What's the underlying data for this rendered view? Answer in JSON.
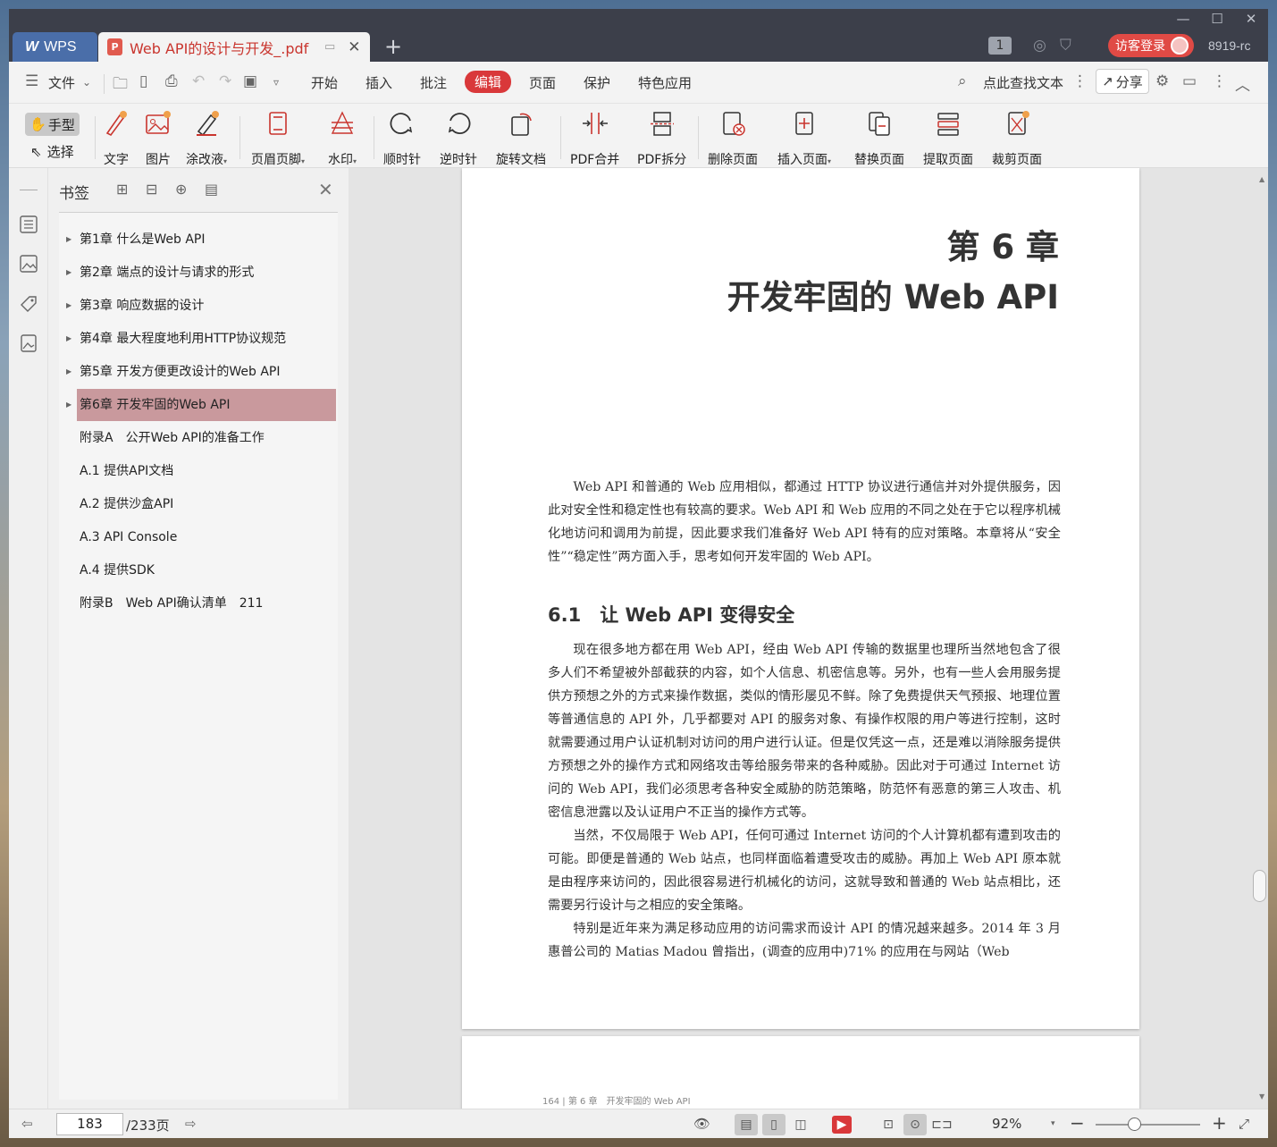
{
  "titlebar": {
    "wps_tab": "WPS",
    "doc_tab": "Web API的设计与开发_.pdf",
    "page_badge": "1",
    "login_button": "访客登录",
    "user_id": "8919-rc"
  },
  "menu": {
    "file": "文件",
    "items": [
      "开始",
      "插入",
      "批注",
      "编辑",
      "页面",
      "保护",
      "特色应用"
    ],
    "active": "编辑",
    "search_text": "点此查找文本",
    "share": "分享"
  },
  "toolbar": {
    "hand": "手型",
    "select": "选择",
    "tools": [
      "文字",
      "图片",
      "涂改液",
      "页眉页脚",
      "水印",
      "顺时针",
      "逆时针",
      "旋转文档",
      "PDF合并",
      "PDF拆分",
      "删除页面",
      "插入页面",
      "替换页面",
      "提取页面",
      "裁剪页面"
    ]
  },
  "bookmarks": {
    "title": "书签",
    "items": [
      {
        "label": "第1章 什么是Web API",
        "expandable": true
      },
      {
        "label": "第2章 端点的设计与请求的形式",
        "expandable": true
      },
      {
        "label": "第3章 响应数据的设计",
        "expandable": true
      },
      {
        "label": "第4章 最大程度地利用HTTP协议规范",
        "expandable": true
      },
      {
        "label": "第5章 开发方便更改设计的Web API",
        "expandable": true
      },
      {
        "label": "第6章 开发牢固的Web API",
        "expandable": true
      },
      {
        "label": "附录A　公开Web API的准备工作",
        "expandable": false
      },
      {
        "label": "A.1 提供API文档",
        "expandable": false
      },
      {
        "label": "A.2 提供沙盒API",
        "expandable": false
      },
      {
        "label": "A.3 API Console",
        "expandable": false
      },
      {
        "label": "A.4 提供SDK",
        "expandable": false
      },
      {
        "label": "附录B　Web API确认清单　211",
        "expandable": false
      }
    ],
    "selected_index": 5
  },
  "document": {
    "chapter_number": "第 6 章",
    "chapter_title": "开发牢固的 Web API",
    "intro": "Web API 和普通的 Web 应用相似，都通过 HTTP 协议进行通信并对外提供服务，因此对安全性和稳定性也有较高的要求。Web API 和 Web 应用的不同之处在于它以程序机械化地访问和调用为前提，因此要求我们准备好 Web API 特有的应对策略。本章将从“安全性”“稳定性”两方面入手，思考如何开发牢固的 Web API。",
    "section_title": "6.1　让 Web API 变得安全",
    "paragraphs": [
      "现在很多地方都在用 Web API，经由 Web API 传输的数据里也理所当然地包含了很多人们不希望被外部截获的内容，如个人信息、机密信息等。另外，也有一些人会用服务提供方预想之外的方式来操作数据，类似的情形屡见不鲜。除了免费提供天气预报、地理位置等普通信息的 API 外，几乎都要对 API 的服务对象、有操作权限的用户等进行控制，这时就需要通过用户认证机制对访问的用户进行认证。但是仅凭这一点，还是难以消除服务提供方预想之外的操作方式和网络攻击等给服务带来的各种威胁。因此对于可通过 Internet 访问的 Web API，我们必须思考各种安全威胁的防范策略，防范怀有恶意的第三人攻击、机密信息泄露以及认证用户不正当的操作方式等。",
      "当然，不仅局限于 Web API，任何可通过 Internet 访问的个人计算机都有遭到攻击的可能。即便是普通的 Web 站点，也同样面临着遭受攻击的威胁。再加上 Web API 原本就是由程序来访问的，因此很容易进行机械化的访问，这就导致和普通的 Web 站点相比，还需要另行设计与之相应的安全策略。",
      "特别是近年来为满足移动应用的访问需求而设计 API 的情况越来越多。2014 年 3 月惠普公司的 Matias Madou 曾指出，(调查的应用中)71% 的应用在与网站（Web"
    ],
    "page2_header": "164  |  第 6 章　开发牢固的 Web API"
  },
  "statusbar": {
    "current_page": "183",
    "total_pages": "/233页",
    "zoom": "92%",
    "zoom_fraction": 0.37
  }
}
